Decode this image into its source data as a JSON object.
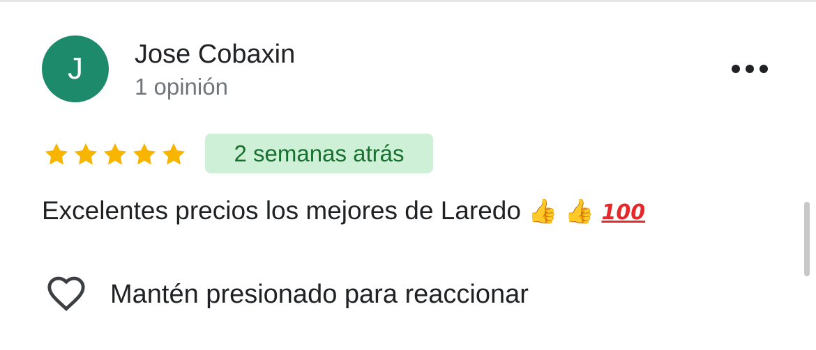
{
  "review": {
    "author": {
      "initial": "J",
      "name": "Jose Cobaxin",
      "review_count": "1 opinión",
      "avatar_color": "#1e8a6c"
    },
    "rating": 5,
    "max_rating": 5,
    "time_ago": "2 semanas atrás",
    "text": "Excelentes precios los mejores de Laredo",
    "emojis": [
      "thumbs-up",
      "thumbs-up",
      "hundred-points"
    ],
    "emoji_glyphs": {
      "thumb_1": "👍",
      "thumb_2": "👍",
      "hundred": "100"
    }
  },
  "actions": {
    "more_icon": "more-horizontal-icon",
    "react_icon": "heart-outline-icon",
    "react_label": "Mantén presionado para reaccionar"
  },
  "colors": {
    "star": "#f7b500",
    "badge_bg": "#cef0d6",
    "badge_text": "#17702f",
    "text_primary": "#202124",
    "text_secondary": "#70757a"
  }
}
